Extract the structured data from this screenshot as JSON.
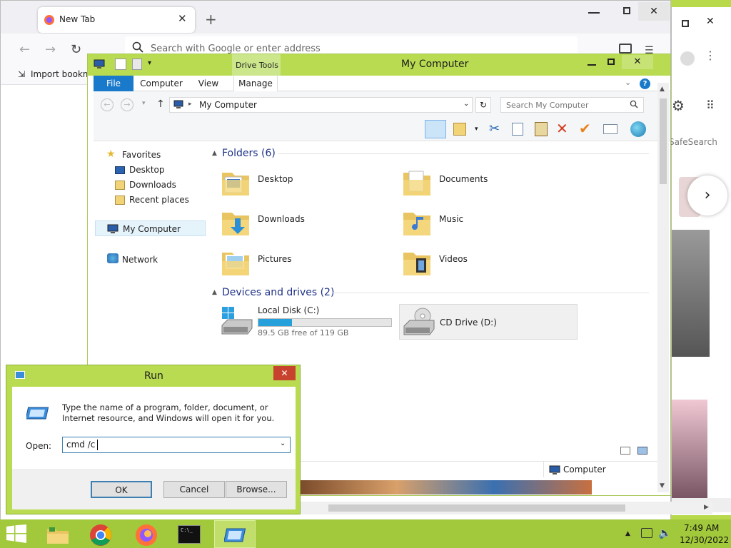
{
  "browser": {
    "tab_title": "New Tab",
    "new_tab_symbol": "+",
    "address_placeholder": "Search with Google or enter address",
    "bookmark_label": "Import bookmarks",
    "safesearch_label": "SafeSearch"
  },
  "explorer": {
    "title": "My Computer",
    "contextual_tab": "Drive Tools",
    "ribbon_tabs": [
      "File",
      "Computer",
      "View",
      "Manage"
    ],
    "address": "My Computer",
    "search_placeholder": "Search My Computer",
    "nav": {
      "favorites": "Favorites",
      "desktop": "Desktop",
      "downloads": "Downloads",
      "recent": "Recent places",
      "computer": "My Computer",
      "network": "Network"
    },
    "folders_header": "Folders (6)",
    "folders": [
      "Desktop",
      "Documents",
      "Downloads",
      "Music",
      "Pictures",
      "Videos"
    ],
    "drives_header": "Devices and drives (2)",
    "drive_c": {
      "name": "Local Disk (C:)",
      "free": "89.5 GB free of 119 GB",
      "used_fraction": 0.25
    },
    "drive_d": {
      "name": "CD Drive (D:)"
    },
    "status": "Computer"
  },
  "run": {
    "title": "Run",
    "description": "Type the name of a program, folder, document, or Internet resource, and Windows will open it for you.",
    "open_label": "Open:",
    "value": "cmd /c",
    "ok": "OK",
    "cancel": "Cancel",
    "browse": "Browse..."
  },
  "taskbar": {
    "time": "7:49 AM",
    "date": "12/30/2022"
  },
  "colors": {
    "accent": "#b9db51",
    "file_tab": "#1979ca",
    "progress": "#26a0da"
  }
}
